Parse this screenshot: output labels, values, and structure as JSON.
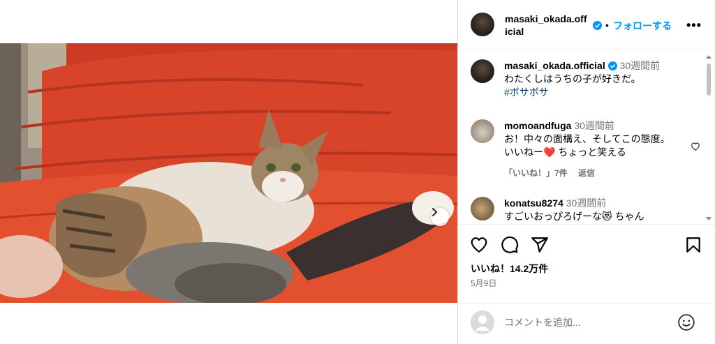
{
  "post": {
    "author": "masaki_okada.official",
    "author_header_line1": "masaki_okada.off",
    "author_header_line2": "icial",
    "follow_label": "フォローする",
    "separator": "•",
    "more_label": "•••",
    "caption": {
      "user": "masaki_okada.official",
      "time": "30週間前",
      "text": "わたくしはうちの子が好きだ。",
      "hashtag": "#ボサボサ"
    },
    "likes": "いいね！14.2万件",
    "date": "5月9日"
  },
  "comments": [
    {
      "user": "momoandfuga",
      "time": "30週間前",
      "text": "お！中々の面構え、そしてこの態度。いいねー❤️ ちょっと笑える",
      "likes": "「いいね！」7件",
      "reply_label": "返信"
    },
    {
      "user": "konatsu8274",
      "time": "30週間前",
      "text": "すごいおっぴろげーな😻 ちゃん"
    }
  ],
  "add_comment": {
    "placeholder": "コメントを追加..."
  },
  "media": {
    "slides": 2,
    "active_slide": 0
  },
  "colors": {
    "link": "#0095f6",
    "verified": "#0095f6",
    "muted_text": "#737373"
  },
  "icons": [
    "heart-icon",
    "comment-icon",
    "share-icon",
    "bookmark-icon",
    "chevron-right-icon",
    "mute-icon",
    "emoji-icon",
    "verified-icon",
    "more-icon"
  ]
}
